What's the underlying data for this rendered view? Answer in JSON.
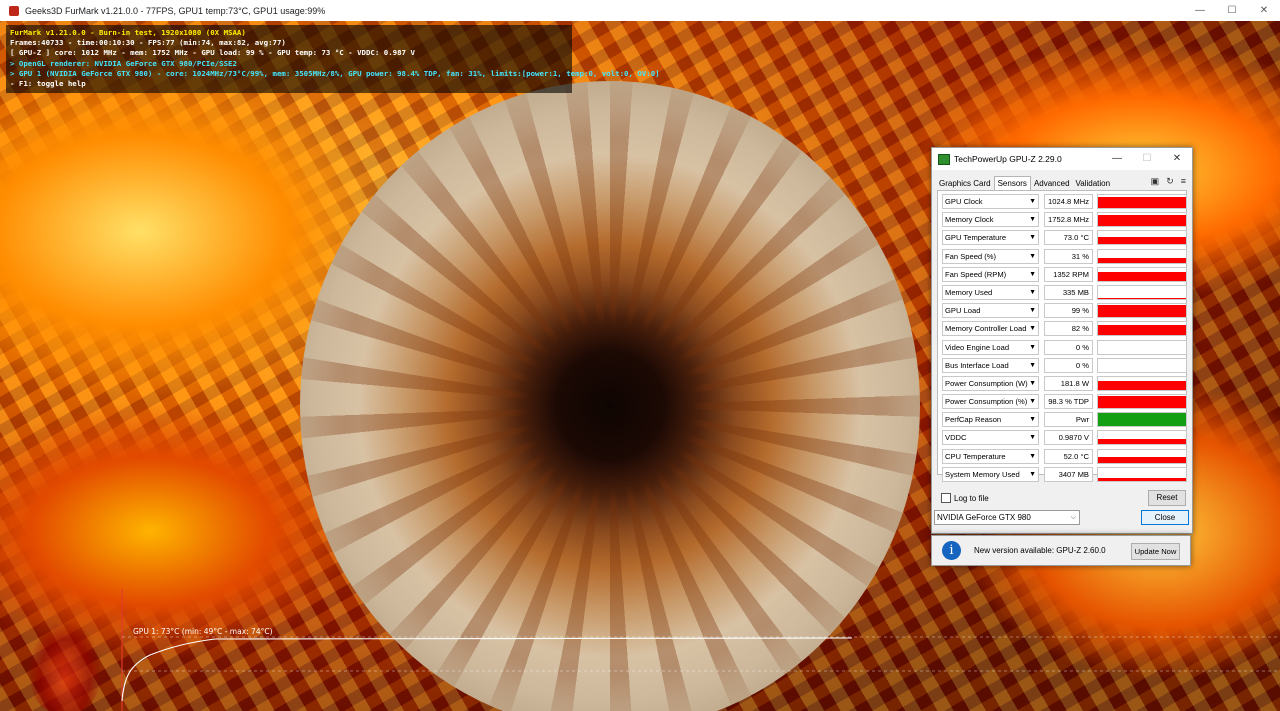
{
  "furmark": {
    "window_title": "Geeks3D FurMark v1.21.0.0 - 77FPS, GPU1 temp:73°C, GPU1 usage:99%",
    "controls": {
      "minimize": "—",
      "maximize": "☐",
      "close": "✕"
    },
    "overlay": [
      {
        "text": "FurMark v1.21.0.0 - Burn-in test, 1920x1080 (0X MSAA)",
        "color": "#ffee00"
      },
      {
        "text": "Frames:40733 - time:00:10:30 - FPS:77 (min:74, max:82, avg:77)",
        "color": "#ffffff"
      },
      {
        "text": "[ GPU-Z ] core: 1012 MHz - mem: 1752 MHz - GPU load: 99 % - GPU temp: 73 °C - VDDC: 0.987 V",
        "color": "#ffffff"
      },
      {
        "text": "> OpenGL renderer: NVIDIA GeForce GTX 980/PCIe/SSE2",
        "color": "#43e6ff"
      },
      {
        "text": "> GPU 1 (NVIDIA GeForce GTX 980) - core: 1024MHz/73°C/99%, mem: 3505MHz/8%, GPU power: 98.4% TDP, fan: 31%, limits:[power:1, temp:0, volt:0, OV:0]",
        "color": "#43e6ff"
      },
      {
        "text": "- F1: toggle help",
        "color": "#ffffff"
      }
    ],
    "graph_label": "GPU 1: 73°C (min: 49°C - max: 74°C)"
  },
  "gpuz": {
    "title": "TechPowerUp GPU-Z 2.29.0",
    "controls": {
      "minimize": "—",
      "maximize": "☐",
      "close": "✕"
    },
    "tabs": [
      {
        "label": "Graphics Card",
        "active": false
      },
      {
        "label": "Sensors",
        "active": true
      },
      {
        "label": "Advanced",
        "active": false
      },
      {
        "label": "Validation",
        "active": false
      }
    ],
    "tool_icons": [
      "camera-icon",
      "refresh-icon",
      "menu-icon"
    ],
    "sensors": [
      {
        "name": "GPU Clock",
        "value": "1024.8 MHz",
        "level": 0.85,
        "color": "#ff0000"
      },
      {
        "name": "Memory Clock",
        "value": "1752.8 MHz",
        "level": 0.85,
        "color": "#ff0000"
      },
      {
        "name": "GPU Temperature",
        "value": "73.0 °C",
        "level": 0.6,
        "color": "#ff0000"
      },
      {
        "name": "Fan Speed (%)",
        "value": "31 %",
        "level": 0.35,
        "color": "#ff0000"
      },
      {
        "name": "Fan Speed (RPM)",
        "value": "1352 RPM",
        "level": 0.7,
        "color": "#ff0000"
      },
      {
        "name": "Memory Used",
        "value": "335 MB",
        "level": 0.1,
        "color": "#ff0000"
      },
      {
        "name": "GPU Load",
        "value": "99 %",
        "level": 0.95,
        "color": "#ff0000"
      },
      {
        "name": "Memory Controller Load",
        "value": "82 %",
        "level": 0.8,
        "color": "#ff0000"
      },
      {
        "name": "Video Engine Load",
        "value": "0 %",
        "level": 0,
        "color": "#ff0000"
      },
      {
        "name": "Bus Interface Load",
        "value": "0 %",
        "level": 0,
        "color": "#ff0000"
      },
      {
        "name": "Power Consumption (W)",
        "value": "181.8 W",
        "level": 0.7,
        "color": "#ff0000"
      },
      {
        "name": "Power Consumption (%)",
        "value": "98.3 % TDP",
        "level": 0.95,
        "color": "#ff0000"
      },
      {
        "name": "PerfCap Reason",
        "value": "Pwr",
        "level": 1,
        "color": "#12a012"
      },
      {
        "name": "VDDC",
        "value": "0.9870 V",
        "level": 0.45,
        "color": "#ff0000"
      },
      {
        "name": "CPU Temperature",
        "value": "52.0 °C",
        "level": 0.45,
        "color": "#ff0000"
      },
      {
        "name": "System Memory Used",
        "value": "3407 MB",
        "level": 0.2,
        "color": "#ff0000"
      }
    ],
    "log_to_file": "Log to file",
    "reset": "Reset",
    "device": "NVIDIA GeForce GTX 980",
    "close": "Close",
    "update": {
      "icon": "i",
      "message": "New version available: GPU-Z 2.60.0",
      "button": "Update Now"
    }
  }
}
